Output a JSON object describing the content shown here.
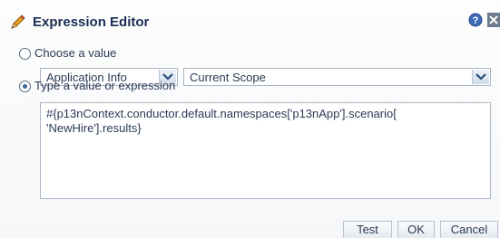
{
  "dialog": {
    "title": "Expression Editor",
    "icons": {
      "title": "pencil-icon",
      "help": "help-icon",
      "close": "close-icon"
    }
  },
  "choose_value": {
    "label": "Choose a value",
    "selected": false,
    "category_select": {
      "value": "Application Info"
    },
    "scope_select": {
      "value": "Current Scope"
    }
  },
  "type_value": {
    "label": "Type a value or expression",
    "selected": true,
    "expression_lines": [
      "#{p13nContext.conductor.default.namespaces['p13nApp'].scenario[",
      "'NewHire'].results}"
    ]
  },
  "footer": {
    "test_label": "Test",
    "ok_label": "OK",
    "cancel_label": "Cancel"
  },
  "colors": {
    "title_text": "#1a2e54",
    "accent": "#3a6a94",
    "border": "#a9b7c6"
  }
}
